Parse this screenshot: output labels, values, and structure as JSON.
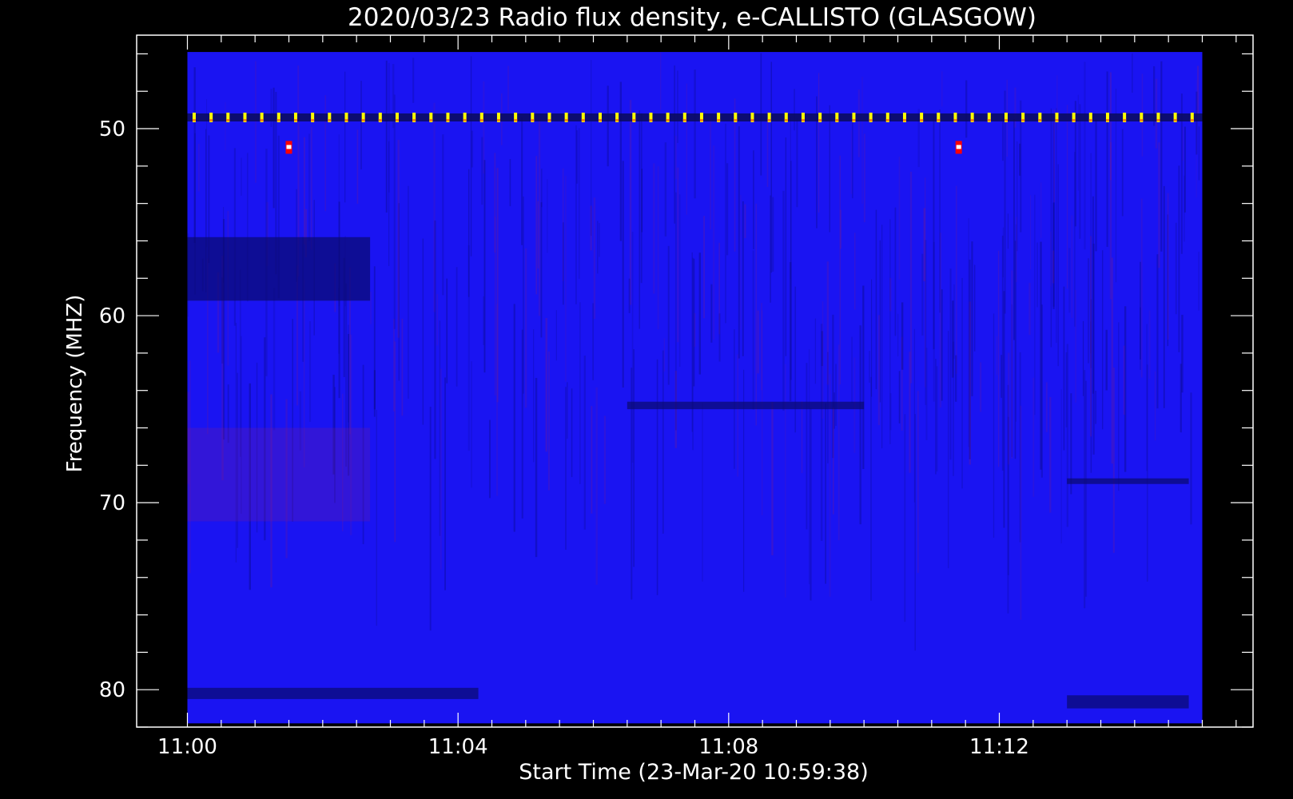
{
  "chart_data": {
    "type": "heatmap",
    "title": "2020/03/23  Radio flux density, e-CALLISTO (GLASGOW)",
    "xlabel": "Start Time (23-Mar-20 10:59:38)",
    "ylabel": "Frequency (MHZ)",
    "x_ticks": [
      "11:00",
      "11:04",
      "11:08",
      "11:12"
    ],
    "x_tick_minutes": [
      0,
      4,
      8,
      12
    ],
    "x_range_minutes": [
      -0.75,
      15.75
    ],
    "data_time_minutes": [
      0,
      15
    ],
    "y_ticks": [
      50,
      60,
      70,
      80
    ],
    "y_range": [
      45,
      82
    ],
    "data_freq_range": [
      45.9,
      81.8
    ],
    "y_inverted": true,
    "colors": {
      "background": "#000000",
      "axes": "#ffffff",
      "heatmap_base": "#1a14f2",
      "interference": "#ffff00",
      "hot": "#ff0000"
    },
    "features": {
      "interference_line_freq": 49.4,
      "interference_period_minutes": 0.25,
      "hot_spots": [
        {
          "time_minutes": 1.5,
          "freq": 51.0
        },
        {
          "time_minutes": 11.4,
          "freq": 51.0
        }
      ],
      "dark_bands": [
        {
          "t0": 0,
          "t1": 2.7,
          "f0": 55.8,
          "f1": 59.2
        },
        {
          "t0": 0,
          "t1": 4.3,
          "f0": 79.9,
          "f1": 80.5
        },
        {
          "t0": 13.0,
          "t1": 14.8,
          "f0": 80.3,
          "f1": 81.0
        },
        {
          "t0": 13.0,
          "t1": 14.8,
          "f0": 68.7,
          "f1": 69.0
        },
        {
          "t0": 6.5,
          "t1": 10.0,
          "f0": 64.6,
          "f1": 65.0
        }
      ]
    }
  }
}
